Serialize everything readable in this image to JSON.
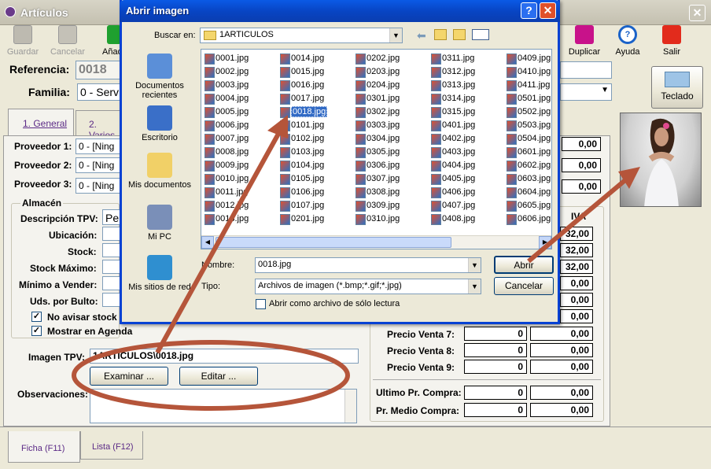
{
  "main_window": {
    "title": "Artículos",
    "close": "✕"
  },
  "toolbar": {
    "guardar": "Guardar",
    "cancelar": "Cancelar",
    "anadir": "Añad",
    "duplicar": "Duplicar",
    "ayuda": "Ayuda",
    "salir": "Salir"
  },
  "header": {
    "referencia_label": "Referencia:",
    "referencia_value": "0018",
    "familia_label": "Familia:",
    "familia_value": "0 - Serv",
    "teclado": "Teclado"
  },
  "tabs": {
    "general": "1. General",
    "varios": "2. Varios"
  },
  "proveedores": {
    "p1_label": "Proveedor 1:",
    "p1_value": "0 - [Ning",
    "p2_label": "Proveedor 2:",
    "p2_value": "0 - [Ning",
    "p3_label": "Proveedor 3:",
    "p3_value": "0 - [Ning",
    "v1": "0,00",
    "v2": "0,00",
    "v3": "0,00"
  },
  "almacen": {
    "group_label": "Almacén",
    "descripcion_label": "Descripción TPV:",
    "descripcion_value": "Pe",
    "ubicacion_label": "Ubicación:",
    "stock_label": "Stock:",
    "stock_max_label": "Stock Máximo:",
    "minimo_label": "Mínimo a Vender:",
    "uds_label": "Uds. por Bulto:",
    "no_avisar": "No avisar stock",
    "mostrar_agenda": "Mostrar en Agenda"
  },
  "imagen": {
    "label": "Imagen TPV:",
    "value": "1ARTICULOS\\0018.jpg",
    "examinar": "Examinar ...",
    "editar": "Editar ..."
  },
  "observaciones_label": "Observaciones:",
  "precios": {
    "iva_header": "IVA",
    "iva_values": [
      "32,00",
      "32,00",
      "32,00",
      "0,00",
      "0,00",
      "0,00"
    ],
    "rows": [
      {
        "label": "Precio Venta 7:",
        "a": "0",
        "b": "0,00"
      },
      {
        "label": "Precio Venta 8:",
        "a": "0",
        "b": "0,00"
      },
      {
        "label": "Precio Venta 9:",
        "a": "0",
        "b": "0,00"
      }
    ],
    "ultimo_label": "Ultimo Pr. Compra:",
    "ultimo_a": "0",
    "ultimo_b": "0,00",
    "medio_label": "Pr. Medio Compra:",
    "medio_a": "0",
    "medio_b": "0,00"
  },
  "bottom_tabs": {
    "ficha": "Ficha (F11)",
    "lista": "Lista (F12)"
  },
  "dialog": {
    "title": "Abrir imagen",
    "help": "?",
    "close": "✕",
    "buscar_label": "Buscar en:",
    "buscar_value": "1ARTICULOS",
    "places": [
      {
        "label": "Documentos recientes",
        "icon": "recent-documents-icon"
      },
      {
        "label": "Escritorio",
        "icon": "desktop-icon"
      },
      {
        "label": "Mis documentos",
        "icon": "my-documents-icon"
      },
      {
        "label": "Mi PC",
        "icon": "my-computer-icon"
      },
      {
        "label": "Mis sitios de red",
        "icon": "network-places-icon"
      }
    ],
    "columns": [
      [
        "0001.jpg",
        "0002.jpg",
        "0003.jpg",
        "0004.jpg",
        "0005.jpg",
        "0006.jpg",
        "0007.jpg",
        "0008.jpg",
        "0009.jpg",
        "0010.jpg",
        "0011.jpg",
        "0012.jpg",
        "0013.jpg"
      ],
      [
        "0014.jpg",
        "0015.jpg",
        "0016.jpg",
        "0017.jpg",
        "0018.jpg",
        "0101.jpg",
        "0102.jpg",
        "0103.jpg",
        "0104.jpg",
        "0105.jpg",
        "0106.jpg",
        "0107.jpg",
        "0201.jpg"
      ],
      [
        "0202.jpg",
        "0203.jpg",
        "0204.jpg",
        "0301.jpg",
        "0302.jpg",
        "0303.jpg",
        "0304.jpg",
        "0305.jpg",
        "0306.jpg",
        "0307.jpg",
        "0308.jpg",
        "0309.jpg",
        "0310.jpg"
      ],
      [
        "0311.jpg",
        "0312.jpg",
        "0313.jpg",
        "0314.jpg",
        "0315.jpg",
        "0401.jpg",
        "0402.jpg",
        "0403.jpg",
        "0404.jpg",
        "0405.jpg",
        "0406.jpg",
        "0407.jpg",
        "0408.jpg"
      ],
      [
        "0409.jpg",
        "0410.jpg",
        "0411.jpg",
        "0501.jpg",
        "0502.jpg",
        "0503.jpg",
        "0504.jpg",
        "0601.jpg",
        "0602.jpg",
        "0603.jpg",
        "0604.jpg",
        "0605.jpg",
        "0606.jpg"
      ]
    ],
    "selected_file": "0018.jpg",
    "nombre_label": "Nombre:",
    "nombre_value": "0018.jpg",
    "tipo_label": "Tipo:",
    "tipo_value": "Archivos de imagen (*.bmp;*.gif;*.jpg)",
    "readonly_label": "Abrir como archivo de sólo lectura",
    "abrir": "Abrir",
    "cancelar": "Cancelar"
  },
  "colors": {
    "dialog_title": "#0a4fd8",
    "selection": "#316ac5",
    "annotation_arrow": "#b5553a",
    "tab_text": "#5b2a86"
  }
}
